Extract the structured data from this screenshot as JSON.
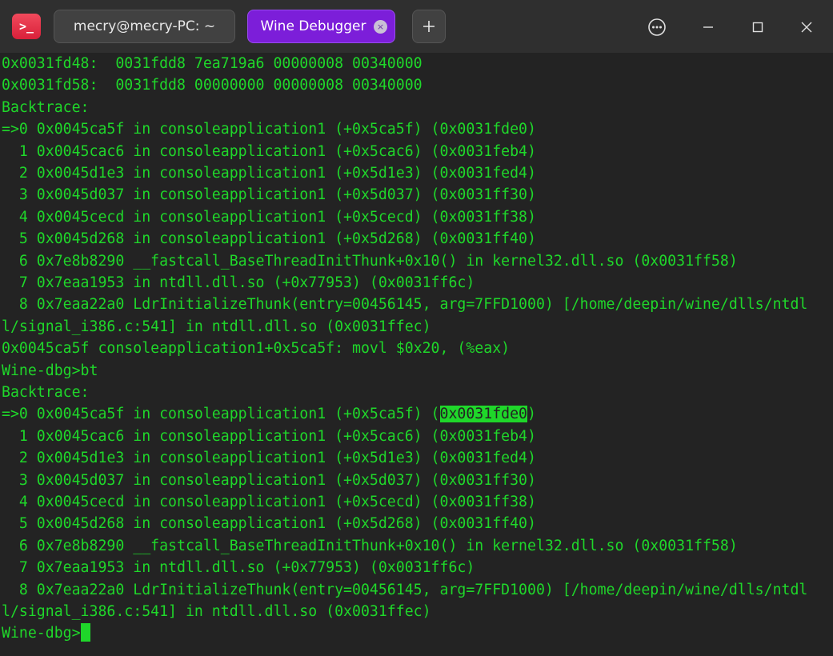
{
  "titlebar": {
    "app_icon_glyph": ">_",
    "tabs": [
      {
        "label": "mecry@mecry-PC: ~",
        "active": false
      },
      {
        "label": "Wine Debugger",
        "active": true
      }
    ],
    "tab_close_glyph": "×",
    "new_tab_icon": "plus-icon",
    "controls": [
      "more-options-icon",
      "minimize-icon",
      "maximize-icon",
      "close-icon"
    ]
  },
  "colors": {
    "terminal_text": "#1fd72a",
    "terminal_background": "#232323",
    "titlebar_background": "#2f2f2f",
    "active_tab": "#7c1ed9",
    "app_icon": "#e23347"
  },
  "terminal": {
    "lines": [
      "0x0031fd48:  0031fdd8 7ea719a6 00000008 00340000",
      "0x0031fd58:  0031fdd8 00000000 00000008 00340000",
      "Backtrace:",
      "=>0 0x0045ca5f in consoleapplication1 (+0x5ca5f) (0x0031fde0)",
      "  1 0x0045cac6 in consoleapplication1 (+0x5cac6) (0x0031feb4)",
      "  2 0x0045d1e3 in consoleapplication1 (+0x5d1e3) (0x0031fed4)",
      "  3 0x0045d037 in consoleapplication1 (+0x5d037) (0x0031ff30)",
      "  4 0x0045cecd in consoleapplication1 (+0x5cecd) (0x0031ff38)",
      "  5 0x0045d268 in consoleapplication1 (+0x5d268) (0x0031ff40)",
      "  6 0x7e8b8290 __fastcall_BaseThreadInitThunk+0x10() in kernel32.dll.so (0x0031ff58)",
      "  7 0x7eaa1953 in ntdll.dll.so (+0x77953) (0x0031ff6c)",
      "  8 0x7eaa22a0 LdrInitializeThunk(entry=00456145, arg=7FFD1000) [/home/deepin/wine/dlls/ntdl",
      "l/signal_i386.c:541] in ntdll.dll.so (0x0031ffec)",
      "0x0045ca5f consoleapplication1+0x5ca5f: movl $0x20, (%eax)",
      "Wine-dbg>bt",
      "Backtrace:",
      "=>0 0x0045ca5f in consoleapplication1 (+0x5ca5f) (",
      "  1 0x0045cac6 in consoleapplication1 (+0x5cac6) (0x0031feb4)",
      "  2 0x0045d1e3 in consoleapplication1 (+0x5d1e3) (0x0031fed4)",
      "  3 0x0045d037 in consoleapplication1 (+0x5d037) (0x0031ff30)",
      "  4 0x0045cecd in consoleapplication1 (+0x5cecd) (0x0031ff38)",
      "  5 0x0045d268 in consoleapplication1 (+0x5d268) (0x0031ff40)",
      "  6 0x7e8b8290 __fastcall_BaseThreadInitThunk+0x10() in kernel32.dll.so (0x0031ff58)",
      "  7 0x7eaa1953 in ntdll.dll.so (+0x77953) (0x0031ff6c)",
      "  8 0x7eaa22a0 LdrInitializeThunk(entry=00456145, arg=7FFD1000) [/home/deepin/wine/dlls/ntdl",
      "l/signal_i386.c:541] in ntdll.dll.so (0x0031ffec)"
    ],
    "selection_text": "0x0031fde0",
    "selection_suffix": ")",
    "prompt": "Wine-dbg>"
  }
}
